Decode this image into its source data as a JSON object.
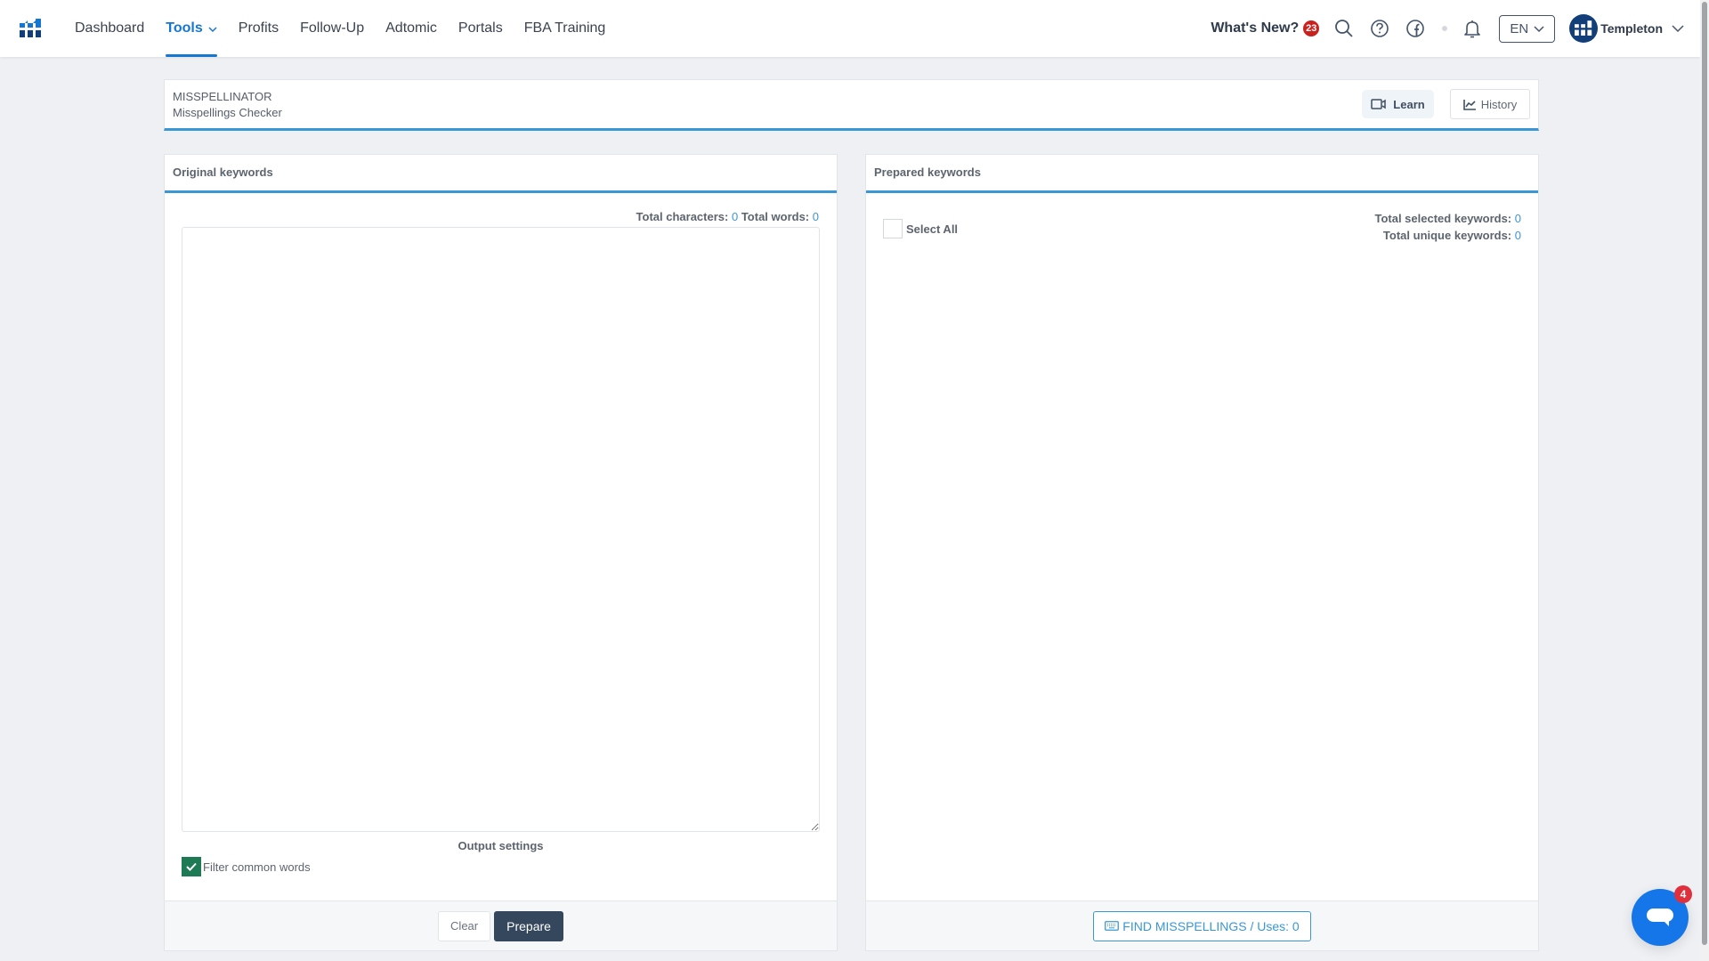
{
  "navbar": {
    "logo": "app-logo-bars",
    "items": [
      {
        "label": "Dashboard",
        "active": false
      },
      {
        "label": "Tools",
        "active": true,
        "has_dropdown": true
      },
      {
        "label": "Profits",
        "active": false
      },
      {
        "label": "Follow-Up",
        "active": false
      },
      {
        "label": "Adtomic",
        "active": false
      },
      {
        "label": "Portals",
        "active": false
      },
      {
        "label": "FBA Training",
        "active": false
      }
    ],
    "whats_new_label": "What's New?",
    "whats_new_count": "23",
    "icons": [
      "search-icon",
      "help-icon",
      "facebook-icon",
      "bell-icon"
    ],
    "language": "EN",
    "user_name": "Templeton"
  },
  "tool_header": {
    "title": "MISSPELLINATOR",
    "subtitle": "Misspellings Checker",
    "learn_label": "Learn",
    "history_label": "History"
  },
  "original_panel": {
    "title": "Original keywords",
    "total_characters_label": "Total characters:",
    "total_characters": "0",
    "total_words_label": "Total words:",
    "total_words": "0",
    "textarea_value": "",
    "output_settings_label": "Output settings",
    "filter_common_words_label": "Filter common words",
    "filter_common_words_checked": true,
    "clear_label": "Clear",
    "prepare_label": "Prepare"
  },
  "prepared_panel": {
    "title": "Prepared keywords",
    "select_all_label": "Select All",
    "select_all_checked": false,
    "total_selected_label": "Total selected keywords:",
    "total_selected": "0",
    "total_unique_label": "Total unique keywords:",
    "total_unique": "0",
    "find_button_label": "FIND MISSPELLINGS / Uses: 0"
  },
  "chat": {
    "unread_count": "4"
  },
  "colors": {
    "accent": "#1677d2",
    "panel_border_accent": "#3a97d6",
    "primary_button": "#34475d",
    "checkbox_checked": "#1e7a54",
    "badge_red": "#c9211e",
    "chat_blue": "#1476e8"
  }
}
